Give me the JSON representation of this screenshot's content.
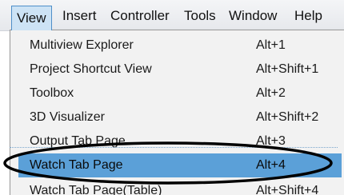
{
  "menubar": {
    "items": [
      {
        "label": "View"
      },
      {
        "label": "Insert"
      },
      {
        "label": "Controller"
      },
      {
        "label": "Tools"
      },
      {
        "label": "Window"
      },
      {
        "label": "Help"
      }
    ]
  },
  "menu": {
    "items": [
      {
        "label": "Multiview Explorer",
        "shortcut": "Alt+1"
      },
      {
        "label": "Project Shortcut View",
        "shortcut": "Alt+Shift+1"
      },
      {
        "label": "Toolbox",
        "shortcut": "Alt+2"
      },
      {
        "label": "3D Visualizer",
        "shortcut": "Alt+Shift+2"
      },
      {
        "label": "Output Tab Page",
        "shortcut": "Alt+3"
      },
      {
        "label": "Watch Tab Page",
        "shortcut": "Alt+4"
      },
      {
        "label": "Watch Tab Page(Table)",
        "shortcut": "Alt+Shift+4"
      }
    ],
    "highlighted_index": 5
  },
  "colors": {
    "highlight": "#5ba0d8",
    "active_menu_bg": "#cde3f5",
    "annotation_oval": "#000000"
  }
}
